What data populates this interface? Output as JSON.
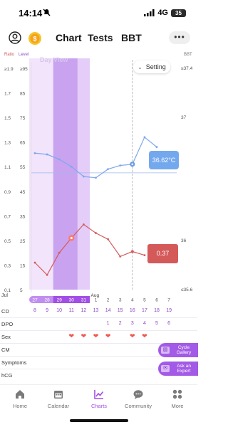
{
  "status_bar": {
    "time": "14:14",
    "silent_icon": "bell-slash-icon",
    "network": "4G",
    "battery": "35"
  },
  "nav": {
    "avatar_icon": "user-circle-icon",
    "coin_icon": "coin-icon",
    "tabs": [
      {
        "label": "Chart",
        "active": true
      },
      {
        "label": "Tests",
        "active": false
      },
      {
        "label": "BBT",
        "active": false
      }
    ],
    "more_label": "•••"
  },
  "chart": {
    "axis_titles": {
      "ratio": "Ratio",
      "level": "Level",
      "bbt": "BBT"
    },
    "view_label": "Day View",
    "setting_label": "Setting",
    "temp_callout": "36.62°C",
    "ratio_callout": "0.37",
    "x_month_labels": [
      "Jul",
      "Aug"
    ]
  },
  "chart_data": {
    "type": "line",
    "x": [
      "Jul 27",
      "Jul 28",
      "Jul 29",
      "Jul 30",
      "Jul 31",
      "Aug 1",
      "Aug 2",
      "Aug 3",
      "Aug 4",
      "Aug 5",
      "Aug 6",
      "Aug 7"
    ],
    "tick_labels": [
      "27",
      "28",
      "29",
      "30",
      "31",
      "1",
      "2",
      "3",
      "4",
      "5",
      "6",
      "7"
    ],
    "ratio_ticks": [
      "≥1.9",
      "1.7",
      "1.5",
      "1.3",
      "1.1",
      "0.9",
      "0.7",
      "0.5",
      "0.3",
      "0.1"
    ],
    "level_ticks": [
      "≥95",
      "85",
      "75",
      "65",
      "55",
      "45",
      "35",
      "25",
      "15",
      "5"
    ],
    "bbt_ticks": [
      "≥37.4",
      "37",
      "36",
      "≤35.6"
    ],
    "series": [
      {
        "name": "Ratio",
        "color": "#d45a5a",
        "values": [
          0.32,
          0.22,
          0.4,
          0.52,
          0.63,
          0.56,
          0.51,
          0.37,
          0.41,
          0.38,
          null,
          null
        ]
      },
      {
        "name": "BBT",
        "color": "#7fa7ee",
        "values": [
          36.71,
          36.7,
          36.66,
          36.6,
          36.52,
          36.51,
          36.58,
          36.61,
          36.62,
          36.84,
          36.76,
          null
        ]
      }
    ],
    "highlight_band": [
      "Jul 29",
      "Jul 31"
    ],
    "peak_marker": "Jul 30",
    "today": "Aug 4"
  },
  "rows": {
    "cd": {
      "label": "CD",
      "values": [
        "8",
        "9",
        "10",
        "11",
        "12",
        "13",
        "14",
        "15",
        "16",
        "17",
        "18",
        "19"
      ]
    },
    "dpo": {
      "label": "DPO",
      "values": [
        "",
        "",
        "",
        "",
        "",
        "",
        "1",
        "2",
        "3",
        "4",
        "5",
        "6"
      ]
    },
    "sex": {
      "label": "Sex",
      "days": [
        false,
        false,
        false,
        true,
        true,
        true,
        true,
        false,
        true,
        true,
        false,
        false
      ]
    },
    "cm": {
      "label": "CM"
    },
    "symptoms": {
      "label": "Symptoms"
    },
    "hcg": {
      "label": "hCG"
    }
  },
  "float_buttons": [
    {
      "label": "Cycle Gallery",
      "icon": "gallery-icon"
    },
    {
      "label": "Ask an Expert",
      "icon": "chat-icon"
    }
  ],
  "bottom_nav": [
    {
      "label": "Home",
      "icon": "home-icon",
      "active": false
    },
    {
      "label": "Calendar",
      "icon": "calendar-icon",
      "active": false
    },
    {
      "label": "Charts",
      "icon": "chart-icon",
      "active": true
    },
    {
      "label": "Community",
      "icon": "community-icon",
      "active": false
    },
    {
      "label": "More",
      "icon": "grid-icon",
      "active": false
    }
  ],
  "colors": {
    "accent": "#a24ee6",
    "ratio": "#d45a5a",
    "bbt": "#7fa7ee",
    "band_light": "#f1e4fb",
    "band_dark": "#c9a3ef"
  }
}
